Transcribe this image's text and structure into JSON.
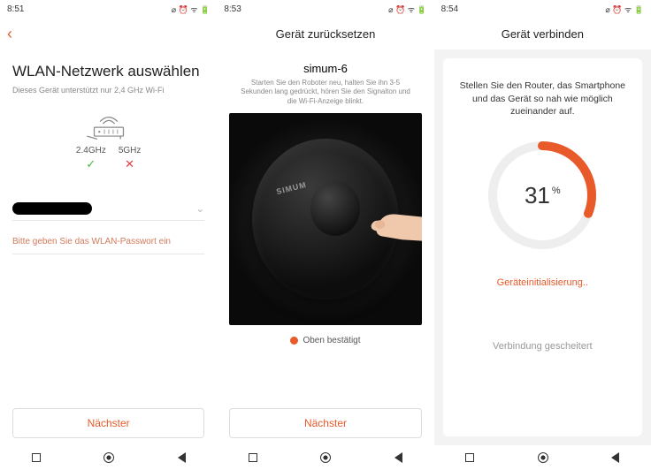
{
  "screen1": {
    "status": {
      "time": "8:51",
      "icons": "⌀ ⏰ ᯤ 🔋"
    },
    "back": "‹",
    "title": "WLAN-Netzwerk auswählen",
    "subtitle": "Dieses Gerät unterstützt nur 2,4 GHz Wi-Fi",
    "freq24": "2.4GHz",
    "freq5": "5GHz",
    "password_placeholder": "Bitte geben Sie das WLAN-Passwort ein",
    "next": "Nächster"
  },
  "screen2": {
    "status": {
      "time": "8:53",
      "icons": "⌀ ⏰ ᯤ 🔋"
    },
    "header": "Gerät zurücksetzen",
    "device": "simum-6",
    "instructions": "Starten Sie den Roboter neu, halten Sie ihn 3-5 Sekunden lang gedrückt, hören Sie den Signalton und die Wi-Fi-Anzeige blinkt.",
    "robot_brand": "SIMUM",
    "confirm": "Oben bestätigt",
    "next": "Nächster"
  },
  "screen3": {
    "status": {
      "time": "8:54",
      "icons": "⌀ ⏰ ᯤ 🔋"
    },
    "header": "Gerät verbinden",
    "card_text": "Stellen Sie den Router, das Smartphone und das Gerät so nah wie möglich zueinander auf.",
    "progress_value": "31",
    "progress_unit": "%",
    "init": "Geräteinitialisierung..",
    "fail": "Verbindung gescheitert"
  }
}
